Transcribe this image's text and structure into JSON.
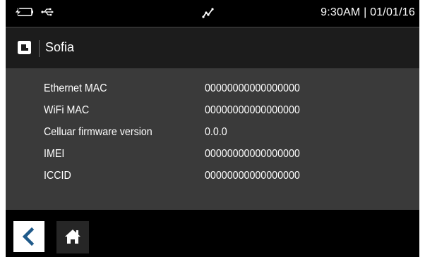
{
  "status_bar": {
    "battery_icon": "battery-charging-icon",
    "usb_icon": "usb-icon",
    "signal_icon": "signal-graph-icon",
    "clock_text": "9:30AM  |  01/01/16"
  },
  "header": {
    "logo_icon": "app-logo-icon",
    "title": "Sofia"
  },
  "info_rows": [
    {
      "label": "Ethernet MAC",
      "value": "00000000000000000"
    },
    {
      "label": "WiFi MAC",
      "value": "00000000000000000"
    },
    {
      "label": "Celluar firmware version",
      "value": "0.0.0"
    },
    {
      "label": "IMEI",
      "value": "00000000000000000"
    },
    {
      "label": "ICCID",
      "value": "00000000000000000"
    }
  ],
  "footer": {
    "back_icon": "chevron-left-icon",
    "home_icon": "home-icon"
  },
  "colors": {
    "content_background": "#3a3a3a",
    "title_bar_background": "#1c1c1c",
    "status_bar_background": "#000000",
    "text": "#ffffff",
    "back_button_icon": "#1f5a8a"
  }
}
